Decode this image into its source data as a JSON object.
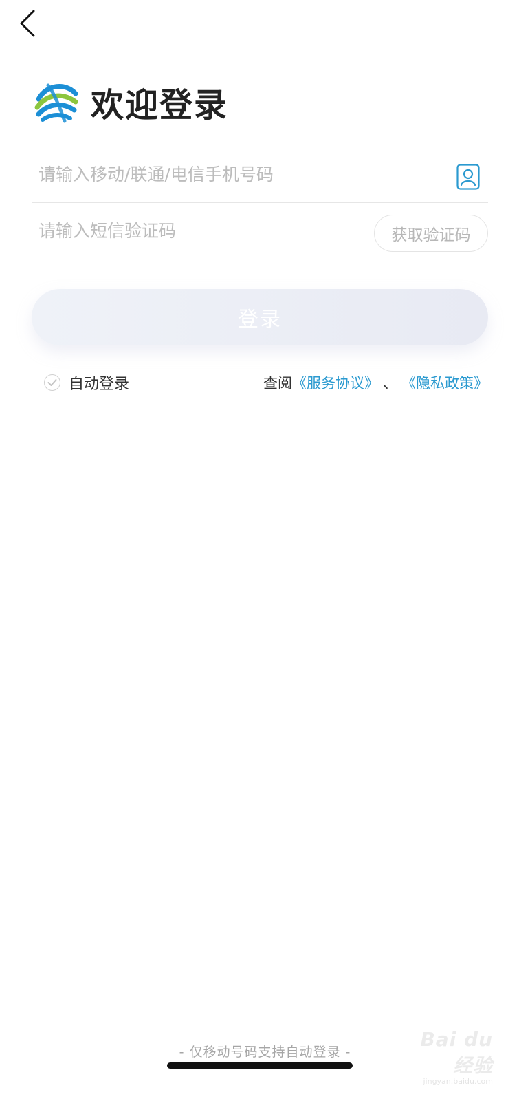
{
  "header": {
    "title": "欢迎登录",
    "logo_icon": "china-mobile-logo"
  },
  "form": {
    "phone_placeholder": "请输入移动/联通/电信手机号码",
    "phone_value": "",
    "code_placeholder": "请输入短信验证码",
    "code_value": "",
    "get_code_label": "获取验证码",
    "login_label": "登录"
  },
  "options": {
    "auto_login_label": "自动登录",
    "auto_login_checked": true,
    "agreement_prefix": "查阅",
    "service_agreement": "《服务协议》",
    "separator": "、",
    "privacy_policy": "《隐私政策》"
  },
  "footer": {
    "note": "- 仅移动号码支持自动登录 -",
    "watermark_main": "Bai du 经验",
    "watermark_sub": "jingyan.baidu.com"
  },
  "colors": {
    "link": "#2b9ad0",
    "contact_icon": "#2b9ad0",
    "logo_blue": "#1c8fd6",
    "logo_green": "#8cc63f"
  }
}
